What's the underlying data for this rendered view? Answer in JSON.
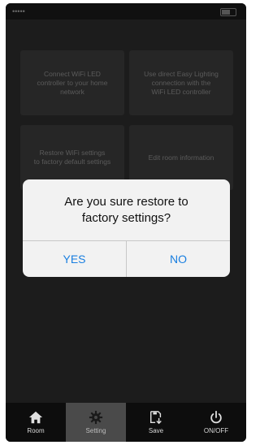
{
  "status_bar": {
    "carrier": "•••••",
    "time": "",
    "battery_icon": "battery-icon"
  },
  "menu": {
    "tiles": [
      {
        "label": "Connect WiFi LED\ncontroller to your home\nnetwork"
      },
      {
        "label": "Use direct Easy Lighting\nconnection with the\nWiFi LED controller"
      },
      {
        "label": "Restore WiFi settings\nto factory default settings"
      },
      {
        "label": "Edit room information"
      }
    ]
  },
  "dialog": {
    "message": "Are you sure restore to\nfactory settings?",
    "yes_label": "YES",
    "no_label": "NO",
    "accent_color": "#1a7fe0"
  },
  "tabbar": {
    "active_tab": "Setting",
    "items": [
      {
        "label": "Room",
        "icon": "home-icon"
      },
      {
        "label": "Setting",
        "icon": "gear-icon"
      },
      {
        "label": "Save",
        "icon": "save-icon"
      },
      {
        "label": "ON/OFF",
        "icon": "power-icon"
      }
    ]
  }
}
